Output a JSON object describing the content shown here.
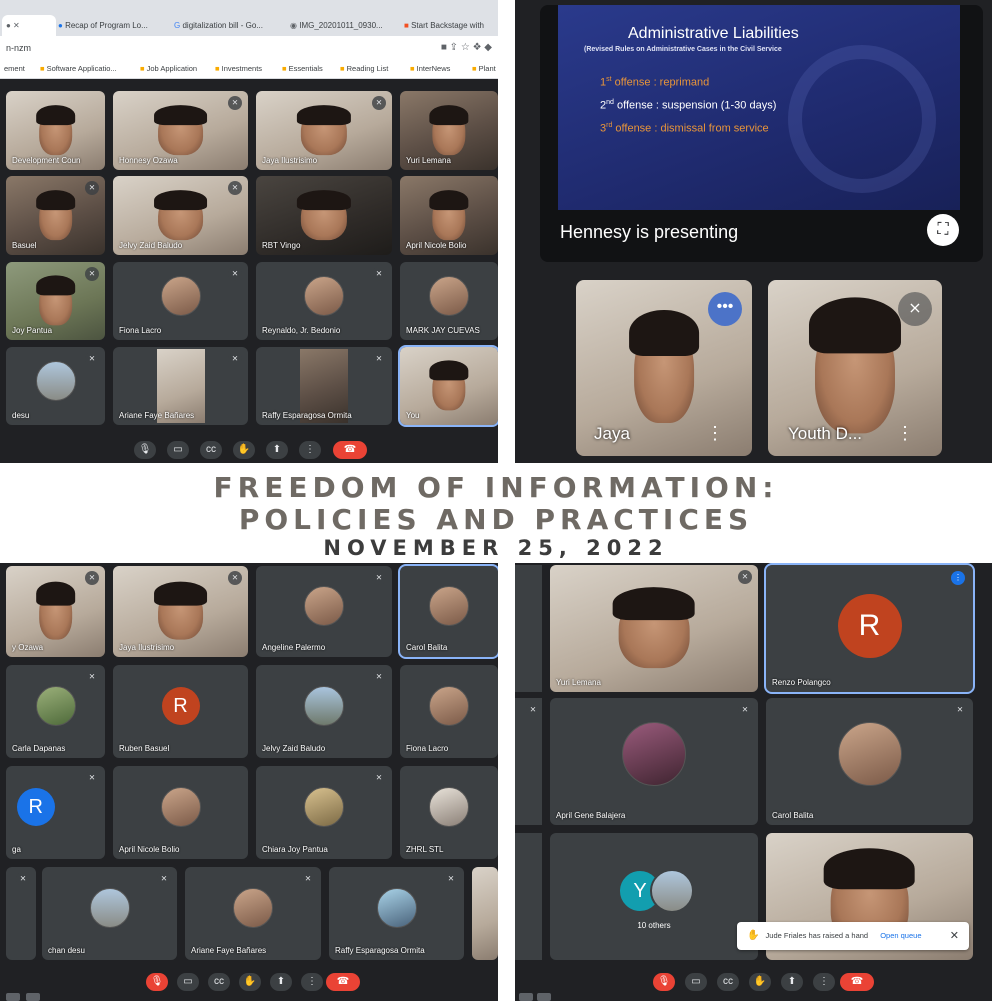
{
  "browser": {
    "tabs": [
      "Recap of Program Lo...",
      "digitalization bill - Go...",
      "IMG_20201011_0930...",
      "Start Backstage with"
    ],
    "url_fragment": "n-nzm",
    "bookmarks": [
      "ement",
      "Software Applicatio...",
      "Job Application",
      "Investments",
      "Essentials",
      "Reading List",
      "InterNews",
      "Plant"
    ]
  },
  "q1": {
    "tiles": [
      {
        "name": "Development Coun"
      },
      {
        "name": "Honnesy Ozawa"
      },
      {
        "name": "Jaya Ilustrisimo"
      },
      {
        "name": "Yuri Lemana"
      },
      {
        "name": "Basuel"
      },
      {
        "name": "Jelvy Zaid Baludo"
      },
      {
        "name": "RBT Vingo"
      },
      {
        "name": "April Nicole Bolio"
      },
      {
        "name": "Joy Pantua"
      },
      {
        "name": "Fiona Lacro"
      },
      {
        "name": "Reynaldo, Jr. Bedonio"
      },
      {
        "name": "MARK JAY CUEVAS"
      },
      {
        "name": "desu"
      },
      {
        "name": "Ariane Faye Bañares"
      },
      {
        "name": "Raffy Esparagosa Ormita"
      },
      {
        "name": "You"
      }
    ]
  },
  "q2": {
    "slide": {
      "title": "Administrative Liabilities",
      "subtitle": "(Revised Rules on Administrative Cases in the Civil Service",
      "items": [
        {
          "ord": "1",
          "sup": "st",
          "text": " offense : reprimand"
        },
        {
          "ord": "2",
          "sup": "nd",
          "text": " offense : suspension (1-30 days)"
        },
        {
          "ord": "3",
          "sup": "rd",
          "text": " offense : dismissal from service"
        }
      ]
    },
    "presenting": "Hennesy is presenting",
    "tiles": [
      {
        "name": "Jaya"
      },
      {
        "name": "Youth D..."
      }
    ]
  },
  "title": {
    "line1": "FREEDOM OF INFORMATION:",
    "line2": "POLICIES AND PRACTICES",
    "line3": "NOVEMBER 25, 2022"
  },
  "q3": {
    "tiles": [
      {
        "name": "y Ozawa"
      },
      {
        "name": "Jaya Ilustrisimo"
      },
      {
        "name": "Angeline Palermo"
      },
      {
        "name": "Carol Balita"
      },
      {
        "name": "Carla Dapanas"
      },
      {
        "name": "Ruben Basuel",
        "letter": "R"
      },
      {
        "name": "Jelvy Zaid Baludo"
      },
      {
        "name": "Fiona Lacro"
      },
      {
        "name": "ga",
        "letter": "R"
      },
      {
        "name": "April Nicole Bolio"
      },
      {
        "name": "Chiara Joy Pantua"
      },
      {
        "name": "ZHRL STL"
      },
      {
        "name": "chan desu"
      },
      {
        "name": "Ariane Faye Bañares"
      },
      {
        "name": "Raffy Esparagosa Ormita"
      }
    ]
  },
  "q4": {
    "tiles": [
      {
        "name": "Yuri Lemana"
      },
      {
        "name": "Renzo Polangco",
        "letter": "R"
      },
      {
        "name": "April Gene Balajera"
      },
      {
        "name": "Carol Balita"
      },
      {
        "name": "10 others",
        "letter": "Y"
      }
    ],
    "toast": {
      "text": "Jude Friales has raised a hand",
      "action": "Open queue"
    }
  },
  "colors": {
    "meet_bg": "#202124",
    "tile_bg": "#3c4043",
    "end_call": "#ea4335",
    "slide_bg": "#1f2a6e",
    "slide_accent": "#e8953a",
    "avatar_r": "#c0431f",
    "avatar_blue": "#1a73e8",
    "avatar_teal": "#129eaf"
  }
}
